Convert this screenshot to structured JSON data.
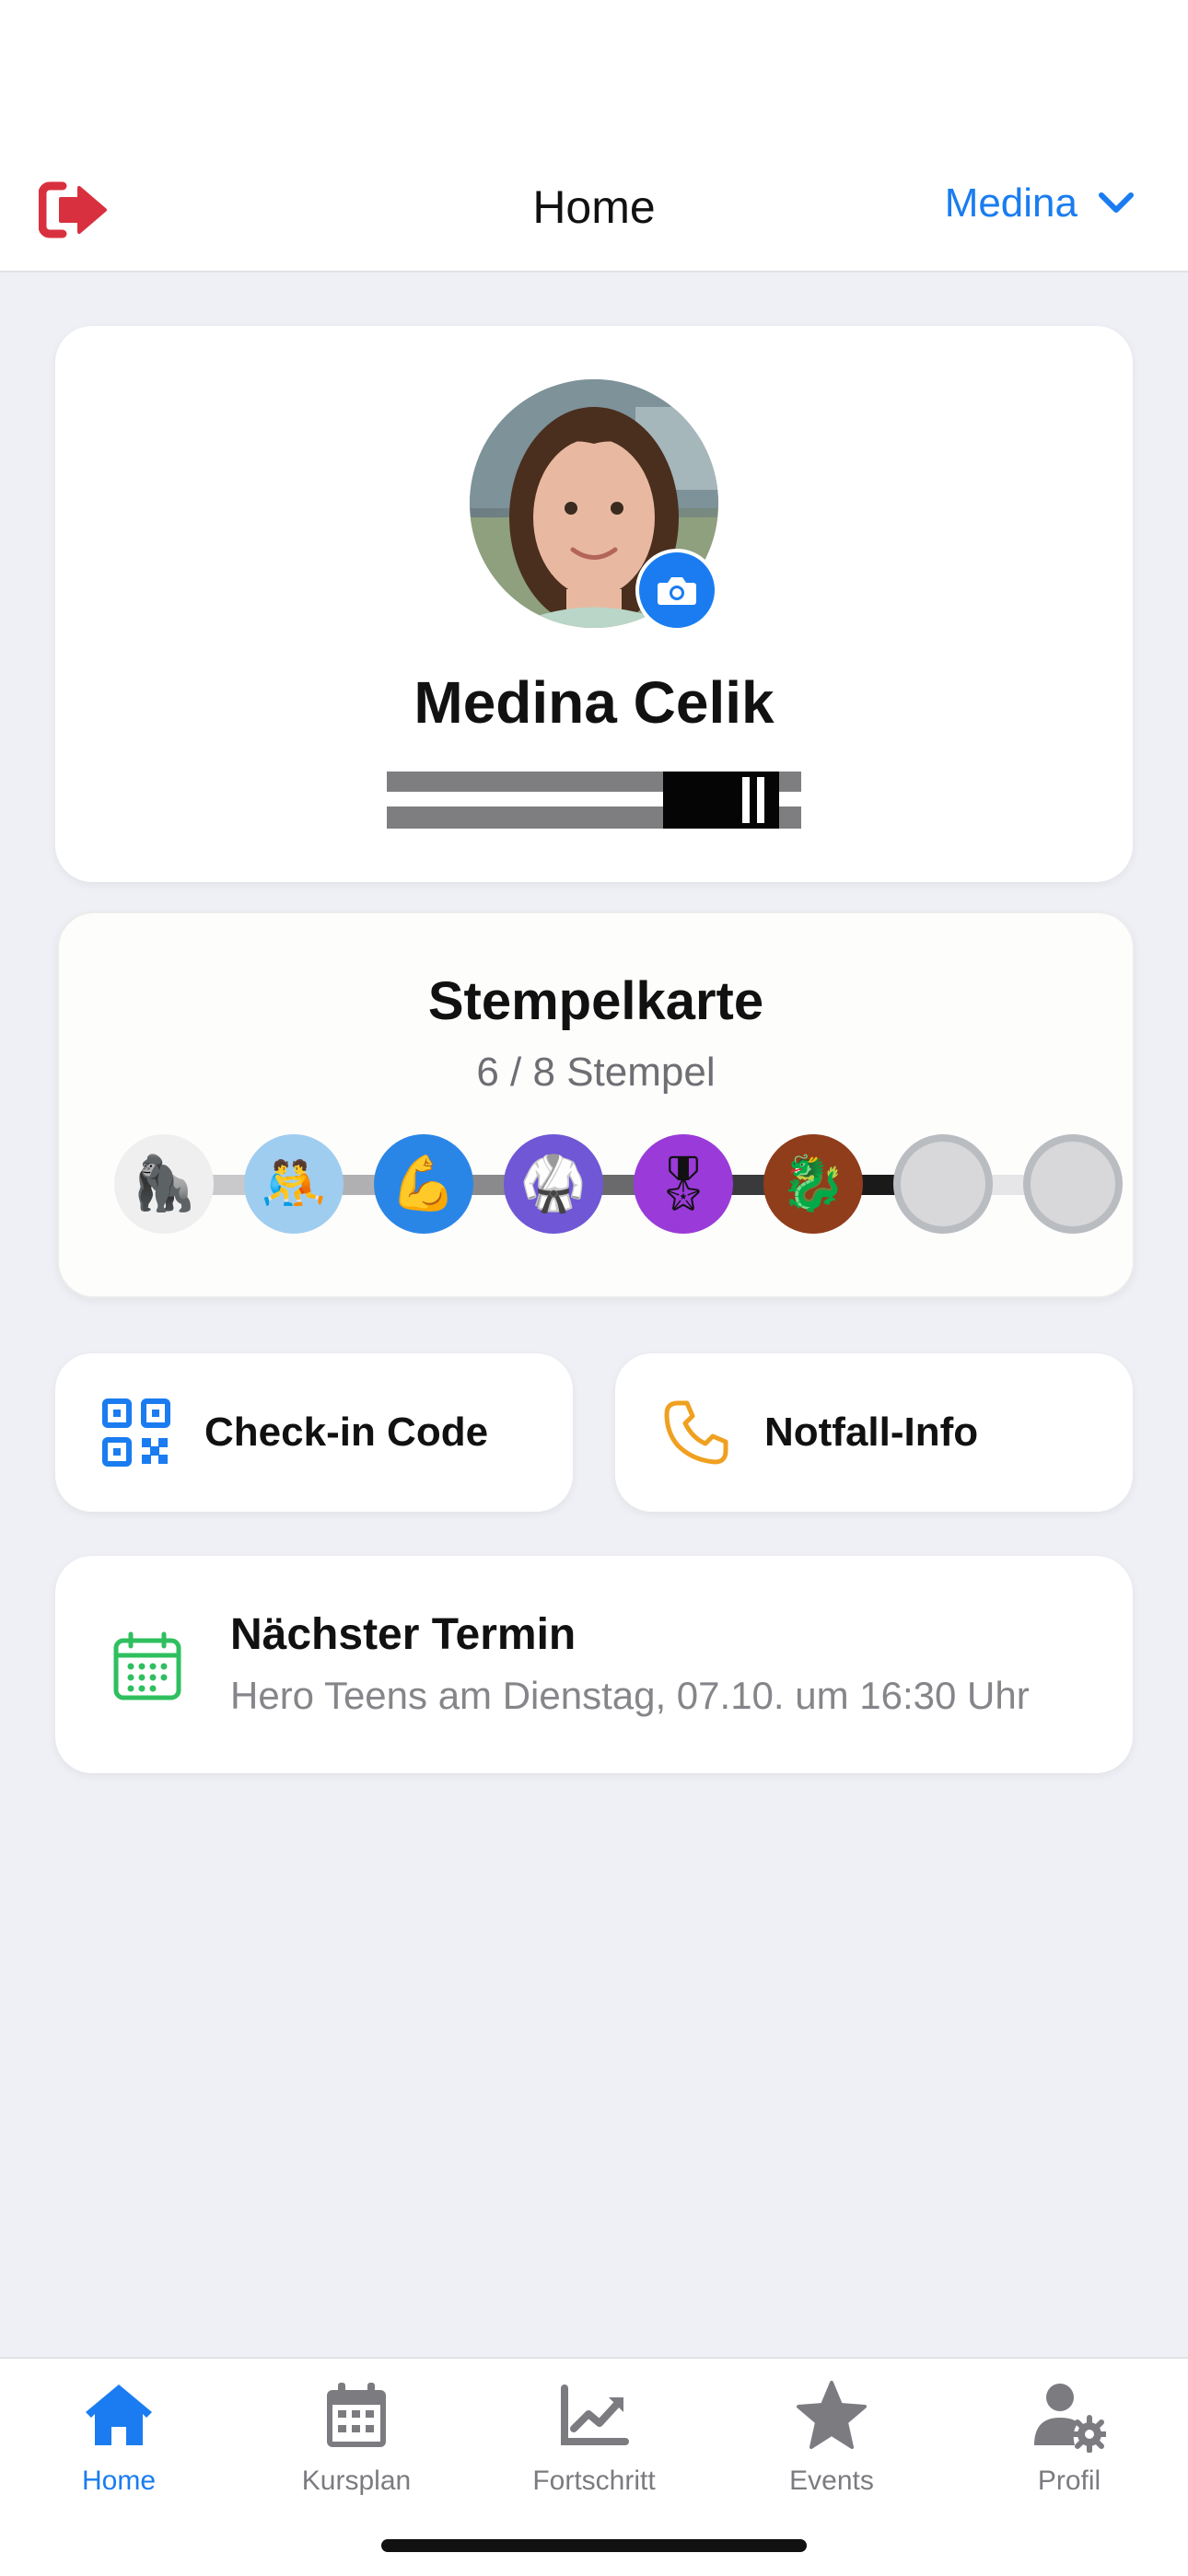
{
  "header": {
    "title": "Home",
    "user_selector": "Medina",
    "logout_icon": "logout-icon"
  },
  "profile": {
    "name": "Medina Celik",
    "camera_icon": "camera-icon",
    "belt": "belt-icon"
  },
  "stamp_card": {
    "title": "Stempelkarte",
    "count_text": "6 / 8 Stempel",
    "collected": 6,
    "total": 8,
    "stamps": [
      {
        "icon": "🦍",
        "bg": "#efefef",
        "filled": true
      },
      {
        "icon": "🤼",
        "bg": "#9fcdf0",
        "filled": true
      },
      {
        "icon": "💪",
        "bg": "#2a86e6",
        "filled": true
      },
      {
        "icon": "🥋",
        "bg": "#6f57d6",
        "filled": true
      },
      {
        "icon": "🎖",
        "bg": "#9a3ad8",
        "filled": true
      },
      {
        "icon": "🐉",
        "bg": "#8f3d1b",
        "filled": true
      },
      {
        "icon": "",
        "bg": "#d8d8da",
        "filled": false
      },
      {
        "icon": "",
        "bg": "#d8d8da",
        "filled": false
      }
    ]
  },
  "actions": {
    "checkin_label": "Check-in Code",
    "emergency_label": "Notfall-Info"
  },
  "next_appointment": {
    "title": "Nächster Termin",
    "subtitle": "Hero Teens am Dienstag, 07.10. um 16:30 Uhr"
  },
  "tabs": [
    {
      "label": "Home",
      "icon": "home-icon",
      "active": true
    },
    {
      "label": "Kursplan",
      "icon": "calendar-icon",
      "active": false
    },
    {
      "label": "Fortschritt",
      "icon": "chart-icon",
      "active": false
    },
    {
      "label": "Events",
      "icon": "star-icon",
      "active": false
    },
    {
      "label": "Profil",
      "icon": "user-gear-icon",
      "active": false
    }
  ],
  "colors": {
    "accent": "#1a7cf0",
    "logout": "#d9303f",
    "emergency": "#f0a020",
    "calendar": "#2fbf5f"
  }
}
